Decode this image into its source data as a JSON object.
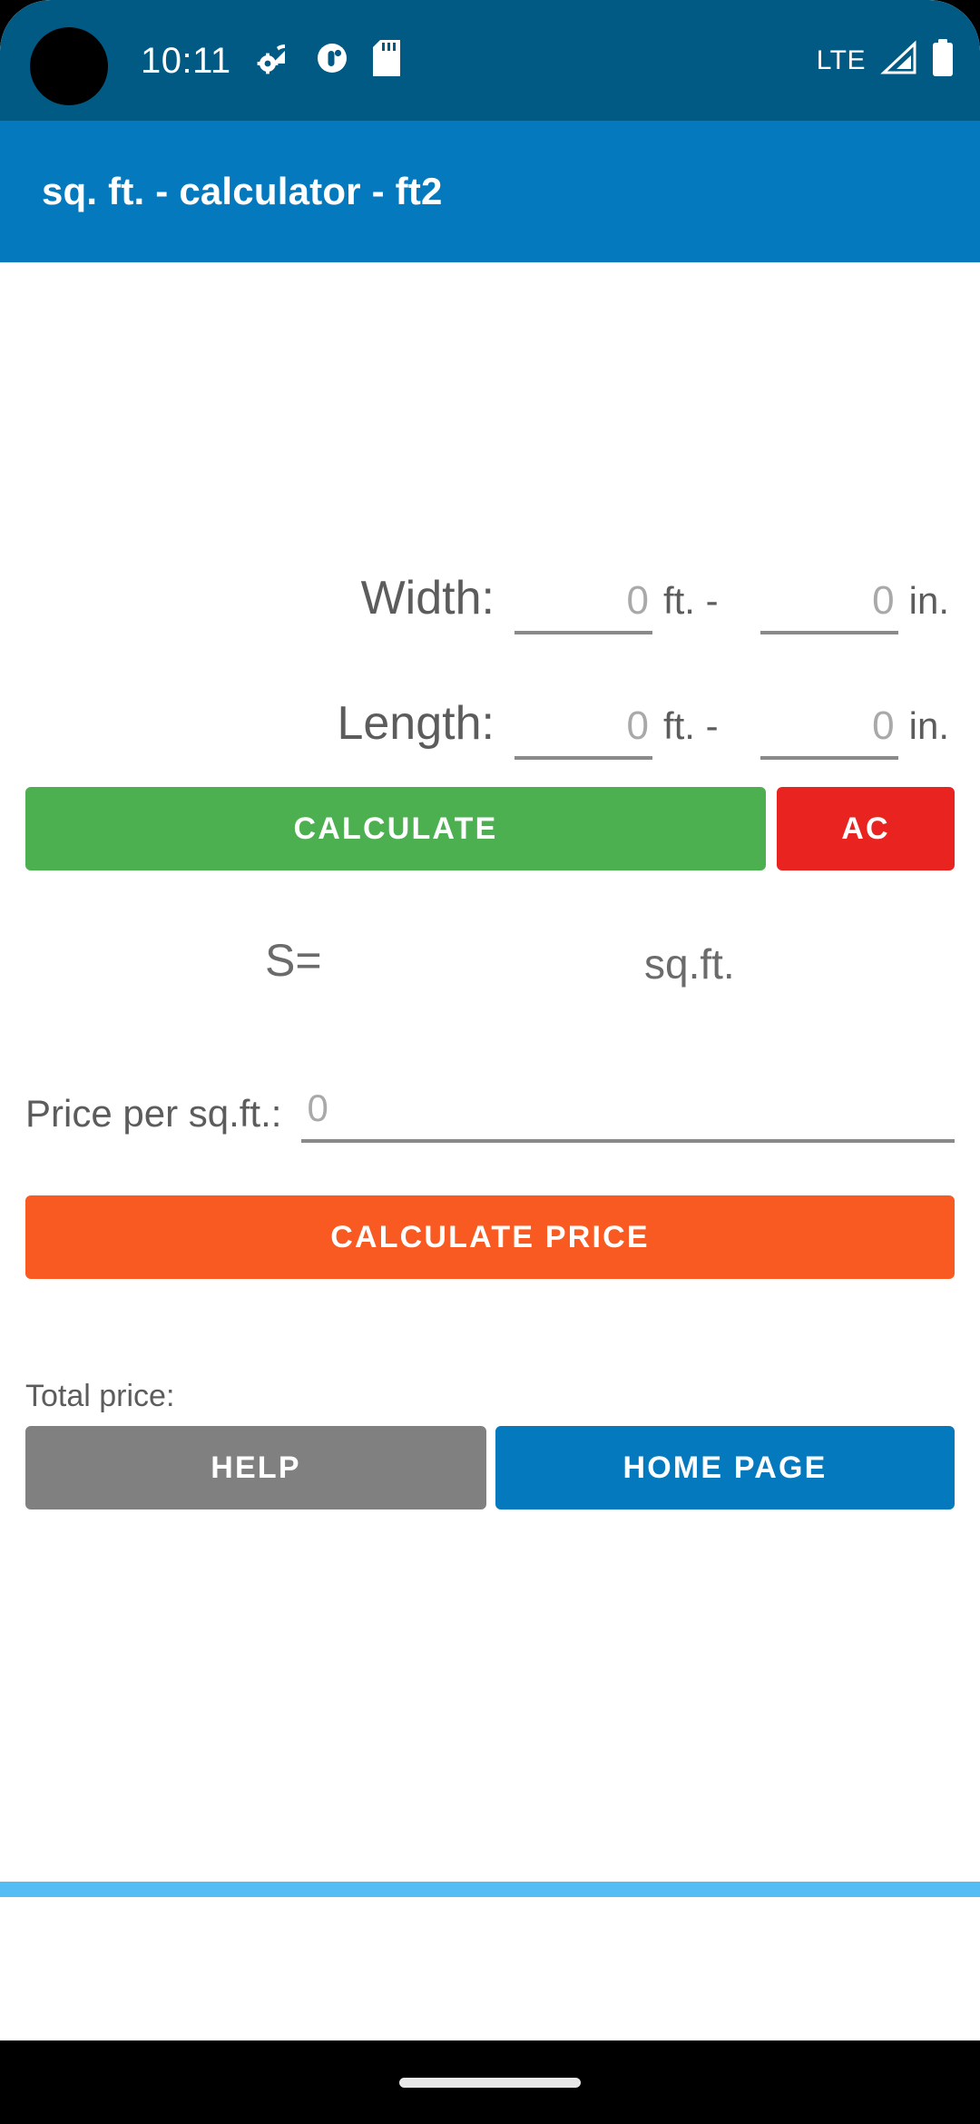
{
  "status_bar": {
    "clock": "10:11",
    "network_label": "LTE",
    "icons": [
      "gear-wifi-icon",
      "circle-dot-icon",
      "sd-card-icon"
    ],
    "right_icons": [
      "signal-bars-icon",
      "battery-full-icon"
    ],
    "background_color": "#015a84"
  },
  "app_bar": {
    "title": "sq. ft. - calculator - ft2",
    "background_color": "#0479be"
  },
  "form": {
    "width": {
      "label": "Width:",
      "feet_value": "",
      "feet_placeholder": "0",
      "feet_unit": "ft. -",
      "inch_value": "",
      "inch_placeholder": "0",
      "inch_unit": "in."
    },
    "length": {
      "label": "Length:",
      "feet_value": "",
      "feet_placeholder": "0",
      "feet_unit": "ft. -",
      "inch_value": "",
      "inch_placeholder": "0",
      "inch_unit": "in."
    },
    "calculate_label": "CALCULATE",
    "ac_label": "AC",
    "calculate_color": "#4caf50",
    "ac_color": "#e92420"
  },
  "result": {
    "s_label": "S=",
    "value": "",
    "unit": "sq.ft."
  },
  "price": {
    "label": "Price per sq.ft.:",
    "value": "",
    "placeholder": "0",
    "calculate_price_label": "CALCULATE PRICE",
    "calculate_price_color": "#f95a21"
  },
  "total": {
    "label": "Total price:",
    "value": ""
  },
  "bottom_buttons": {
    "help_label": "HELP",
    "help_color": "#808080",
    "home_page_label": "HOME PAGE",
    "home_page_color": "#0479be"
  },
  "divider": {
    "color": "#55bdf3"
  }
}
